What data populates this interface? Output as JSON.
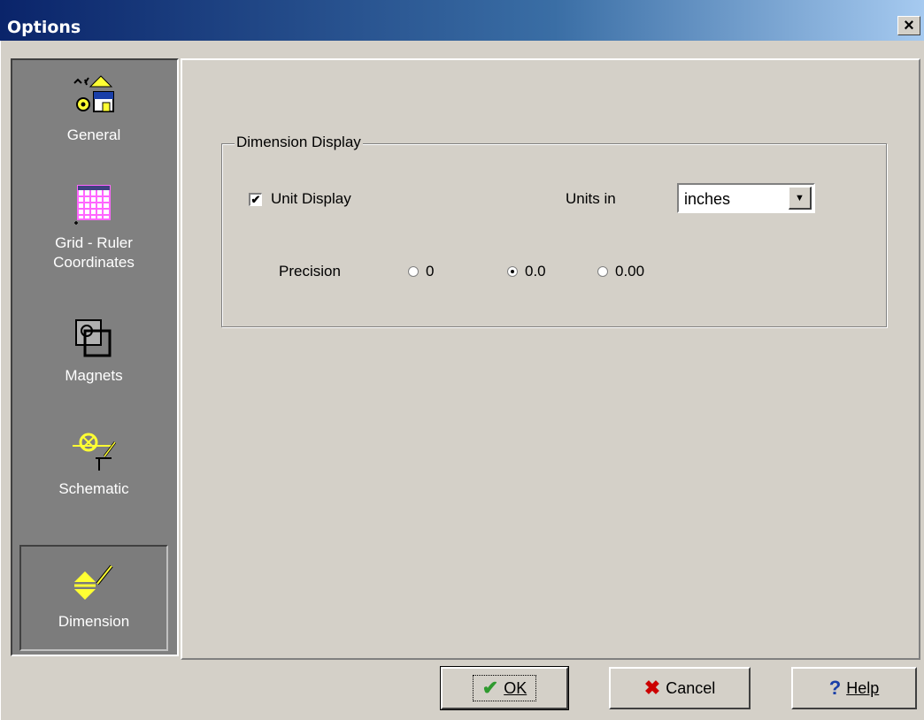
{
  "window": {
    "title": "Options",
    "close_label": "×"
  },
  "sidebar": {
    "items": [
      {
        "label": "General",
        "icon": "general-icon"
      },
      {
        "label": "Grid - Ruler Coordinates",
        "label_line1": "Grid - Ruler",
        "label_line2": "Coordinates",
        "icon": "grid-icon"
      },
      {
        "label": "Magnets",
        "icon": "magnet-icon"
      },
      {
        "label": "Schematic",
        "icon": "schematic-icon"
      },
      {
        "label": "Dimension",
        "icon": "dimension-icon",
        "selected": true
      }
    ]
  },
  "dimension_display": {
    "group_title": "Dimension Display",
    "unit_display_label": "Unit Display",
    "unit_display_checked": true,
    "units_in_label": "Units in",
    "units_value": "inches",
    "precision_label": "Precision",
    "precision_options": [
      "0",
      "0.0",
      "0.00"
    ],
    "precision_selected": "0.0"
  },
  "buttons": {
    "ok": "OK",
    "cancel": "Cancel",
    "help": "Help"
  },
  "colors": {
    "title_bar": "#0a246a",
    "sidebar_bg": "#808080",
    "face": "#d4d0c8",
    "ok_check": "#2f9a2f",
    "cancel_x": "#cc0000",
    "help_q": "#1a3fa8",
    "icon_yellow": "#ffff33"
  }
}
